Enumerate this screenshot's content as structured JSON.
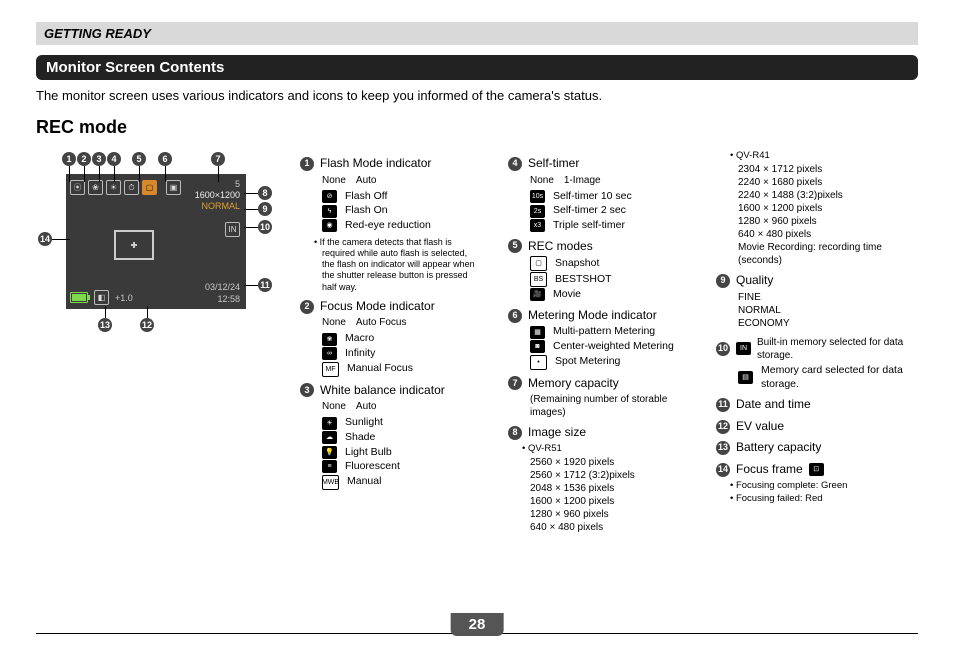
{
  "section": "GETTING READY",
  "title": "Monitor Screen Contents",
  "intro": "The monitor screen uses various indicators and icons to keep you informed of the camera's status.",
  "mode_title": "REC mode",
  "page_num": "28",
  "screen": {
    "shots": "5",
    "size": "1600×1200",
    "quality": "NORMAL",
    "date": "03/12/24",
    "time": "12:58",
    "ev": "+1.0"
  },
  "items": {
    "i1": {
      "title": "Flash Mode indicator",
      "sub1": "None",
      "sub2": "Auto",
      "opts": [
        [
          "flash-off",
          "Flash Off"
        ],
        [
          "flash-on",
          "Flash On"
        ],
        [
          "redeye",
          "Red-eye reduction"
        ]
      ],
      "note": "• If the camera detects that flash is required while auto flash is selected, the flash on indicator will appear when the shutter release button is pressed half way."
    },
    "i2": {
      "title": "Focus Mode indicator",
      "sub1": "None",
      "sub2": "Auto Focus",
      "opts": [
        [
          "macro",
          "Macro"
        ],
        [
          "infinity",
          "Infinity"
        ],
        [
          "mf",
          "Manual Focus"
        ]
      ]
    },
    "i3": {
      "title": "White balance indicator",
      "sub1": "None",
      "sub2": "Auto",
      "opts": [
        [
          "sun",
          "Sunlight"
        ],
        [
          "shade",
          "Shade"
        ],
        [
          "bulb",
          "Light Bulb"
        ],
        [
          "fluor",
          "Fluorescent"
        ],
        [
          "mwb",
          "Manual"
        ]
      ]
    },
    "i4": {
      "title": "Self-timer",
      "sub1": "None",
      "sub2": "1-Image",
      "opts": [
        [
          "t10",
          "Self-timer 10 sec"
        ],
        [
          "t2",
          "Self-timer 2 sec"
        ],
        [
          "tx3",
          "Triple self-timer"
        ]
      ]
    },
    "i5": {
      "title": "REC modes",
      "opts": [
        [
          "snap",
          "Snapshot"
        ],
        [
          "bs",
          "BESTSHOT"
        ],
        [
          "mov",
          "Movie"
        ]
      ]
    },
    "i6": {
      "title": "Metering Mode indicator",
      "opts": [
        [
          "multi",
          "Multi-pattern Metering"
        ],
        [
          "center",
          "Center-weighted Metering"
        ],
        [
          "spot",
          "Spot Metering"
        ]
      ]
    },
    "i7": {
      "title": "Memory capacity",
      "sub": "(Remaining number of storable images)"
    },
    "i8": {
      "title": "Image size",
      "groupA": {
        "name": "• QV-R51",
        "lines": [
          "2560 × 1920 pixels",
          "2560 × 1712 (3:2)pixels",
          "2048 × 1536 pixels",
          "1600 × 1200 pixels",
          "1280 ×   960 pixels",
          "  640 ×   480 pixels"
        ]
      },
      "groupB": {
        "name": "• QV-R41",
        "lines": [
          "2304 × 1712 pixels",
          "2240 × 1680 pixels",
          "2240 × 1488 (3:2)pixels",
          "1600 × 1200 pixels",
          "1280 ×   960 pixels",
          "  640 ×   480 pixels",
          "Movie Recording: recording time (seconds)"
        ]
      }
    },
    "i9": {
      "title": "Quality",
      "vals": [
        "FINE",
        "NORMAL",
        "ECONOMY"
      ]
    },
    "i10": {
      "opts": [
        [
          "in",
          "Built-in memory selected for data storage."
        ],
        [
          "card",
          "Memory card selected for data storage."
        ]
      ]
    },
    "i11": {
      "title": "Date and time"
    },
    "i12": {
      "title": "EV value"
    },
    "i13": {
      "title": "Battery capacity"
    },
    "i14": {
      "title": "Focus frame",
      "notes": [
        "• Focusing complete: Green",
        "• Focusing failed: Red"
      ]
    }
  }
}
